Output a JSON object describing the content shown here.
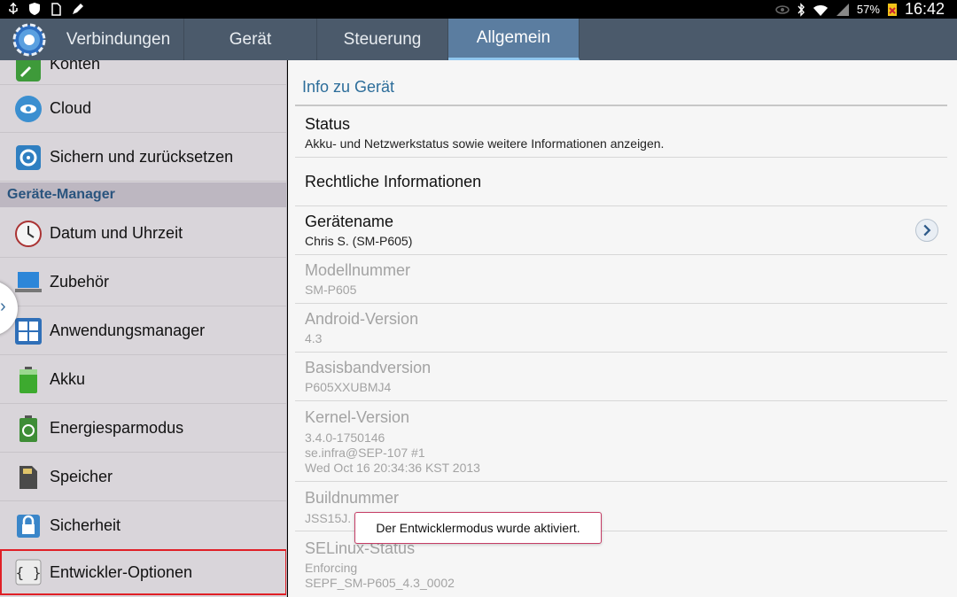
{
  "status_bar": {
    "battery": "57%",
    "time": "16:42",
    "icons": [
      "usb-icon",
      "shield-icon",
      "sd-card-icon",
      "pen-icon",
      "eye-icon",
      "bluetooth-icon",
      "wifi-icon",
      "signal-icon",
      "battery-icon"
    ]
  },
  "tabs": [
    {
      "label": "Verbindungen"
    },
    {
      "label": "Gerät"
    },
    {
      "label": "Steuerung"
    },
    {
      "label": "Allgemein",
      "active": true
    }
  ],
  "sidebar": {
    "items_top": [
      {
        "label": "Konten",
        "icon": "key-icon"
      },
      {
        "label": "Cloud",
        "icon": "cloud-icon"
      },
      {
        "label": "Sichern und zurücksetzen",
        "icon": "restore-icon"
      }
    ],
    "section_header": "Geräte-Manager",
    "items": [
      {
        "label": "Datum und Uhrzeit",
        "icon": "clock-icon"
      },
      {
        "label": "Zubehör",
        "icon": "laptop-icon"
      },
      {
        "label": "Anwendungsmanager",
        "icon": "apps-grid-icon"
      },
      {
        "label": "Akku",
        "icon": "battery-icon"
      },
      {
        "label": "Energiesparmodus",
        "icon": "recycle-icon"
      },
      {
        "label": "Speicher",
        "icon": "sd-card-icon"
      },
      {
        "label": "Sicherheit",
        "icon": "lock-icon"
      },
      {
        "label": "Entwickler-Optionen",
        "icon": "braces-icon",
        "highlighted": true
      }
    ]
  },
  "content": {
    "section_title": "Info zu Gerät",
    "rows": [
      {
        "title": "Status",
        "subtitle": "Akku- und Netzwerkstatus sowie weitere Informationen anzeigen.",
        "enabled": true
      },
      {
        "title": "Rechtliche Informationen",
        "subtitle": "",
        "enabled": true
      },
      {
        "title": "Gerätename",
        "subtitle": "Chris S. (SM-P605)",
        "enabled": true,
        "has_chevron": true
      },
      {
        "title": "Modellnummer",
        "subtitle": "SM-P605",
        "enabled": false
      },
      {
        "title": "Android-Version",
        "subtitle": "4.3",
        "enabled": false
      },
      {
        "title": "Basisbandversion",
        "subtitle": "P605XXUBMJ4",
        "enabled": false
      },
      {
        "title": "Kernel-Version",
        "subtitle": "3.4.0-1750146\nse.infra@SEP-107 #1\nWed Oct 16 20:34:36 KST 2013",
        "enabled": false
      },
      {
        "title": "Buildnummer",
        "subtitle": "JSS15J.",
        "enabled": false
      },
      {
        "title": "SELinux-Status",
        "subtitle": "Enforcing\nSEPF_SM-P605_4.3_0002",
        "enabled": false
      }
    ]
  },
  "toast": "Der Entwicklermodus wurde aktiviert.",
  "colors": {
    "tab_bar": "#4b5a6b",
    "tab_active": "#5b7da0",
    "section_title": "#2c6d9a",
    "highlight_border": "#e01f26"
  }
}
